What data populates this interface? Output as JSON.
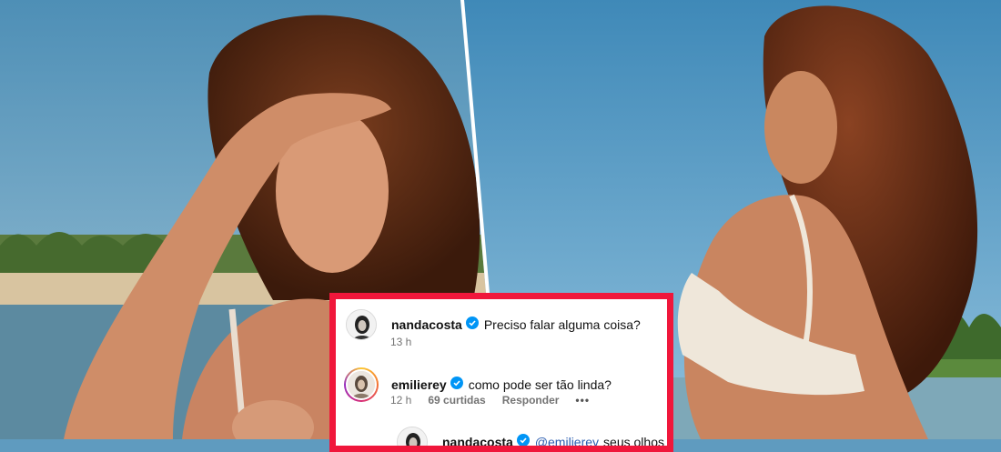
{
  "comments": [
    {
      "user": "nandacosta",
      "text": "Preciso falar alguma coisa?",
      "time": "13 h"
    },
    {
      "user": "emilierey",
      "text": "como pode ser tão linda?",
      "time": "12 h",
      "likes": "69 curtidas",
      "reply": "Responder",
      "more": "•••"
    },
    {
      "user": "nandacosta",
      "mention": "@emilierey",
      "text": "seus olhos"
    }
  ],
  "colors": {
    "frame": "#f0173b",
    "verified": "#0095f6",
    "sky": "#5f9bbf"
  },
  "icons": [
    "verified-badge-icon",
    "more-options-icon"
  ]
}
